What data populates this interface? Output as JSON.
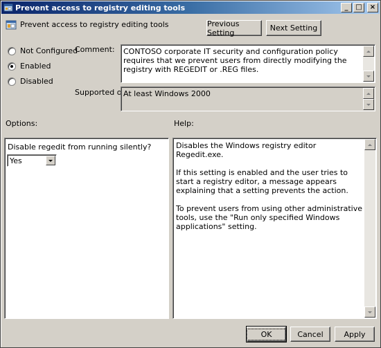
{
  "window": {
    "title": "Prevent access to registry editing tools",
    "controls": {
      "minimize": "_",
      "maximize": "□",
      "close": "×"
    }
  },
  "header": {
    "setting_name": "Prevent access to registry editing tools",
    "previous_button": "Previous Setting",
    "next_button": "Next Setting"
  },
  "state": {
    "options": [
      {
        "label": "Not Configured",
        "checked": false
      },
      {
        "label": "Enabled",
        "checked": true
      },
      {
        "label": "Disabled",
        "checked": false
      }
    ]
  },
  "comment": {
    "label": "Comment:",
    "value": "CONTOSO corporate IT security and configuration policy requires that we prevent users from directly modifying the registry with REGEDIT or .REG files."
  },
  "supported": {
    "label": "Supported on:",
    "value": "At least Windows 2000"
  },
  "options_panel": {
    "label": "Options:",
    "question": "Disable regedit from running silently?",
    "selected": "Yes"
  },
  "help_panel": {
    "label": "Help:",
    "paragraphs": [
      "Disables the Windows registry editor Regedit.exe.",
      "If this setting is enabled and the user tries to start a registry editor, a message appears explaining that a setting prevents the action.",
      "To prevent users from using other administrative tools, use the \"Run only specified Windows applications\" setting."
    ]
  },
  "footer": {
    "ok": "OK",
    "cancel": "Cancel",
    "apply": "Apply"
  }
}
